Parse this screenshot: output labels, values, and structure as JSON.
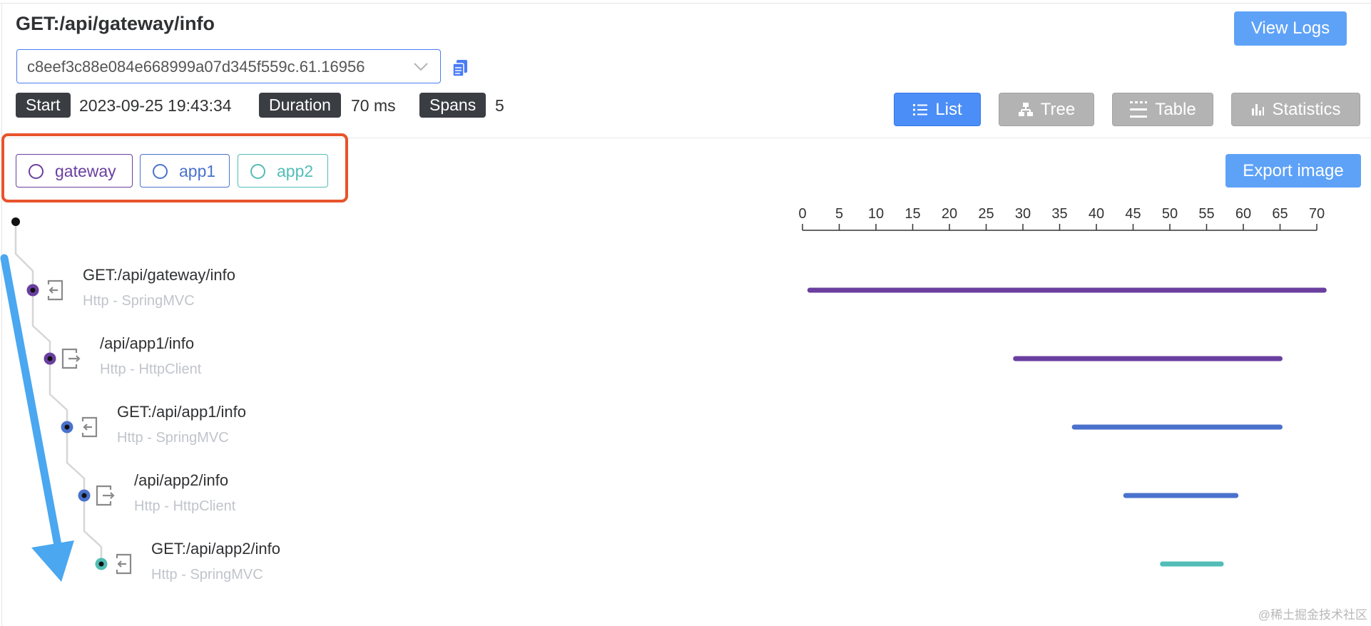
{
  "page": {
    "title": "GET:/api/gateway/info",
    "trace_id": "c8eef3c88e084e668999a07d345f559c.61.16956",
    "view_logs_label": "View Logs",
    "export_label": "Export image",
    "watermark": "@稀土掘金技术社区"
  },
  "meta": [
    {
      "label": "Start",
      "value": "2023-09-25 19:43:34"
    },
    {
      "label": "Duration",
      "value": "70 ms"
    },
    {
      "label": "Spans",
      "value": "5"
    }
  ],
  "views": [
    {
      "label": "List",
      "icon": "list-icon",
      "active": true
    },
    {
      "label": "Tree",
      "icon": "tree-icon",
      "active": false
    },
    {
      "label": "Table",
      "icon": "table-icon",
      "active": false
    },
    {
      "label": "Statistics",
      "icon": "bar-chart-icon",
      "active": false
    }
  ],
  "services": [
    {
      "name": "gateway",
      "color": "#6a3fa0"
    },
    {
      "name": "app1",
      "color": "#4a72cc"
    },
    {
      "name": "app2",
      "color": "#52bdb6"
    }
  ],
  "axis": {
    "ticks": [
      "0",
      "5",
      "10",
      "15",
      "20",
      "25",
      "30",
      "35",
      "40",
      "45",
      "50",
      "55",
      "60",
      "65",
      "70"
    ],
    "max": 70
  },
  "spans": [
    {
      "name": "GET:/api/gateway/info",
      "sub": "Http - SpringMVC",
      "service": "gateway",
      "kind": "entry",
      "start": 1,
      "end": 71
    },
    {
      "name": "/api/app1/info",
      "sub": "Http - HttpClient",
      "service": "gateway",
      "kind": "exit",
      "start": 29,
      "end": 65
    },
    {
      "name": "GET:/api/app1/info",
      "sub": "Http - SpringMVC",
      "service": "app1",
      "kind": "entry",
      "start": 37,
      "end": 65
    },
    {
      "name": "/api/app2/info",
      "sub": "Http - HttpClient",
      "service": "app1",
      "kind": "exit",
      "start": 44,
      "end": 59
    },
    {
      "name": "GET:/api/app2/info",
      "sub": "Http - SpringMVC",
      "service": "app2",
      "kind": "entry",
      "start": 49,
      "end": 57
    }
  ]
}
